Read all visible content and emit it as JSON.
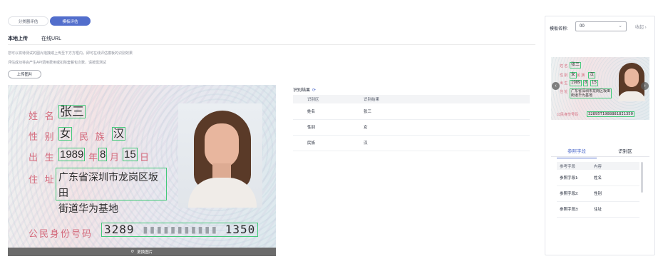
{
  "mode_tabs": [
    {
      "label": "分类器评估",
      "active": false
    },
    {
      "label": "模板评估",
      "active": true
    }
  ],
  "sub_tabs": [
    {
      "label": "本地上传",
      "active": true
    },
    {
      "label": "在线URL",
      "active": false
    }
  ],
  "hints": [
    "您可以将待测试的图片拖拽或上传至下方方框内，即可在线评估模板的识别效果",
    "评估成功将会产生API调用费用或扣除套餐包次数，请按需测试"
  ],
  "upload_button": "上传图片",
  "id_card": {
    "fields": [
      {
        "label": "姓 名",
        "value": "张三"
      },
      {
        "label": "性 别",
        "value": "女"
      },
      {
        "label": "民 族",
        "value": "汉"
      },
      {
        "label": "出 生",
        "value": "1989"
      },
      {
        "label": "年",
        "value": "8"
      },
      {
        "label": "月",
        "value": "15"
      },
      {
        "label": "日",
        "value": ""
      },
      {
        "label": "住 址",
        "value": "广东省深圳市龙岗区坂田"
      },
      {
        "label": "",
        "value": "街道华为基地"
      }
    ],
    "id_label": "公民身份号码",
    "id_number_start": "3289",
    "id_number_end": "1350"
  },
  "replace_image_label": "更换图片",
  "result": {
    "title": "识别结果",
    "columns": [
      "识别区",
      "识别结果"
    ],
    "rows": [
      [
        "姓名",
        "张三"
      ],
      [
        "性别",
        "女"
      ],
      [
        "民族",
        "汉"
      ]
    ]
  },
  "right_panel": {
    "template_label": "模板名称:",
    "template_value": "00",
    "collapse_label": "收起",
    "thumb": {
      "name_label": "姓 名",
      "name_value": "张三",
      "sex_label": "性 别",
      "sex_value": "女",
      "ethnic_label": "民 族",
      "ethnic_value": "汉",
      "birth_label": "出 生",
      "birth_year": "1989",
      "birth_month": "8",
      "birth_day": "15",
      "address_label": "住 址",
      "address_value_1": "广东省深圳市龙岗区坂田",
      "address_value_2": "街道华为基地",
      "id_label": "公民身份号码",
      "id_number": "32895T19888818I1350"
    },
    "tabs": [
      {
        "label": "参照字段",
        "active": true
      },
      {
        "label": "识别区",
        "active": false
      }
    ],
    "table": {
      "columns": [
        "参考字段",
        "内容"
      ],
      "rows": [
        [
          "参照字段1:",
          "姓名"
        ],
        [
          "参照字段2:",
          "性别"
        ],
        [
          "参照字段3:",
          "住址"
        ]
      ]
    }
  },
  "colors": {
    "accent": "#526ecc",
    "box": "#44c97a",
    "card_label": "#d46a7c"
  }
}
